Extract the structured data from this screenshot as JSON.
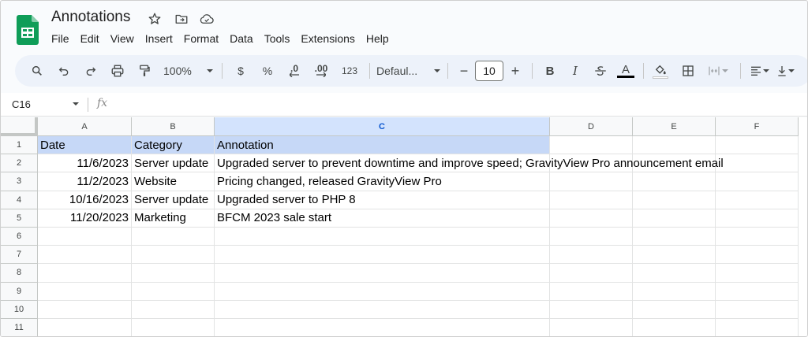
{
  "document": {
    "title": "Annotations"
  },
  "title_icons": [
    "star-icon",
    "move-to-folder-icon",
    "cloud-saved-icon"
  ],
  "menu": [
    "File",
    "Edit",
    "View",
    "Insert",
    "Format",
    "Data",
    "Tools",
    "Extensions",
    "Help"
  ],
  "toolbar": {
    "zoom": "100%",
    "currency": "$",
    "percent": "%",
    "decrease_decimals": ".0",
    "increase_decimals": ".00",
    "number_format": "123",
    "font": "Defaul...",
    "font_size": "10",
    "minus": "−",
    "plus": "+",
    "bold": "B",
    "italic": "I",
    "text_color_label": "A"
  },
  "formula_bar": {
    "name_box": "C16",
    "fx_label": "fx",
    "value": ""
  },
  "sheet": {
    "columns": [
      "A",
      "B",
      "C",
      "D",
      "E",
      "F"
    ],
    "selected_column": "C",
    "rows": [
      "1",
      "2",
      "3",
      "4",
      "5",
      "6",
      "7",
      "8",
      "9",
      "10",
      "11"
    ],
    "cells": [
      [
        "Date",
        "Category",
        "Annotation"
      ],
      [
        "11/6/2023",
        "Server update",
        "Upgraded server to prevent downtime and improve speed; GravityView Pro announcement email"
      ],
      [
        "11/2/2023",
        "Website",
        "Pricing changed, released GravityView Pro"
      ],
      [
        "10/16/2023",
        "Server update",
        "Upgraded server to PHP 8"
      ],
      [
        "11/20/2023",
        "Marketing",
        "BFCM 2023 sale start"
      ]
    ]
  },
  "colors": {
    "header_highlight": "#c6d8f7",
    "selected_column_header": "#d3e3fd",
    "toolbar_bg": "#edf2fa",
    "sheets_green": "#0f9d58"
  }
}
